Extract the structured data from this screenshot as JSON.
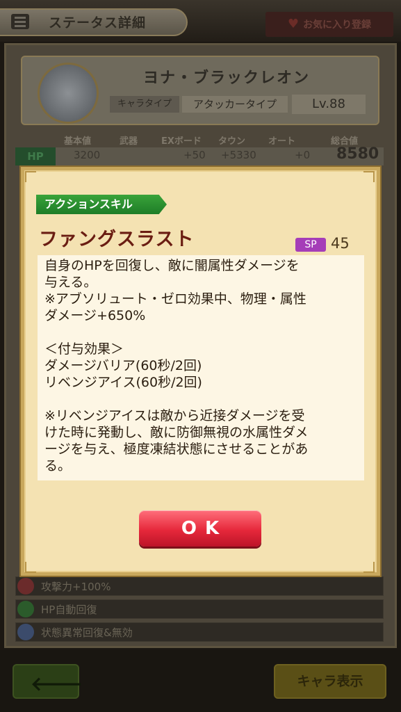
{
  "header": {
    "title": "ステータス詳細",
    "favorite_label": "お気に入り登録"
  },
  "character": {
    "name": "ヨナ・ブラックレオン",
    "type_label": "キャラタイプ",
    "type_value": "アタッカータイプ",
    "level": "Lv.88"
  },
  "stats": {
    "headers": [
      "基本値",
      "武器",
      "EXボード",
      "タウン",
      "オート",
      "総合値"
    ],
    "hp": {
      "label": "HP",
      "base": "3200",
      "weapon": "",
      "ex_board": "+50",
      "town": "+5330",
      "auto": "+0",
      "total": "8580"
    }
  },
  "auto_skills": [
    {
      "label": "攻撃力+100%",
      "gem_color": "#6b2b2b"
    },
    {
      "label": "HP自動回復",
      "gem_color": "#2b5b2b"
    },
    {
      "label": "状態異常回復&無効",
      "gem_color": "#3b4b6b"
    }
  ],
  "footer": {
    "back_icon": "left-arrow-icon",
    "chara_view_label": "キャラ表示"
  },
  "dialog": {
    "skill_type": "アクションスキル",
    "skill_name": "ファングスラスト",
    "sp_label": "SP",
    "sp_value": "45",
    "description": "自身のHPを回復し、敵に闇属性ダメージを\n与える。\n※アブソリュート・ゼロ効果中、物理・属性\nダメージ+650%\n\n＜付与効果＞\nダメージバリア(60秒/2回)\nリベンジアイス(60秒/2回)\n\n※リベンジアイスは敵から近接ダメージを受\nけた時に発動し、敵に防御無視の水属性ダメ\nージを与え、極度凍結状態にさせることがあ\nる。",
    "ok_label": "OK"
  },
  "colors": {
    "dialog_bg": "#f4e2b2",
    "skill_tag_green": "#2a8f31",
    "skill_name_red": "#6a1d12",
    "sp_purple": "#a53db8",
    "ok_red": "#e6283b"
  }
}
